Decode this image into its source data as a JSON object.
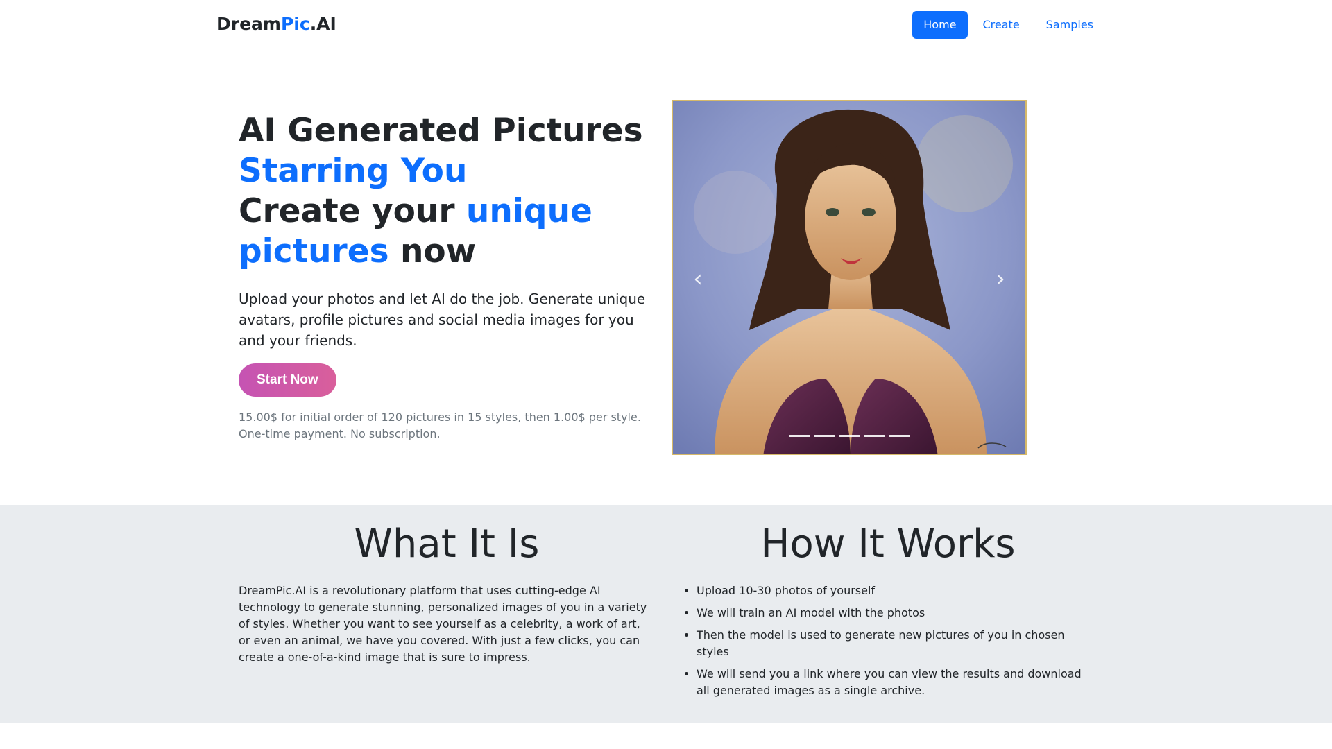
{
  "brand": {
    "part1": "Dream",
    "part2": "Pic",
    "part3": ".AI"
  },
  "nav": {
    "home": "Home",
    "create": "Create",
    "samples": "Samples"
  },
  "hero": {
    "line1": "AI Generated Pictures",
    "line2": "Starring You",
    "line3a": "Create your ",
    "line3b": "unique",
    "line4a": "pictures",
    "line4b": " now",
    "lead": "Upload your photos and let AI do the job. Generate unique avatars, profile pictures and social media images for you and your friends.",
    "cta": "Start Now",
    "price_line1": "15.00$ for initial order of 120 pictures in 15 styles, then 1.00$ per style.",
    "price_line2": "One-time payment. No subscription."
  },
  "carousel": {
    "prev_icon": "chevron-left-icon",
    "next_icon": "chevron-right-icon",
    "slides": 5,
    "active": 0
  },
  "what": {
    "title": "What It Is",
    "text": "DreamPic.AI is a revolutionary platform that uses cutting-edge AI technology to generate stunning, personalized images of you in a variety of styles. Whether you want to see yourself as a celebrity, a work of art, or even an animal, we have you covered. With just a few clicks, you can create a one-of-a-kind image that is sure to impress."
  },
  "how": {
    "title": "How It Works",
    "steps": [
      "Upload 10-30 photos of yourself",
      "We will train an AI model with the photos",
      "Then the model is used to generate new pictures of you in chosen styles",
      "We will send you a link where you can view the results and download all generated images as a single archive."
    ]
  },
  "colors": {
    "accent": "#0d6efd",
    "band": "#e9ecef",
    "cta_start": "#c553b3",
    "cta_end": "#d95f9b"
  }
}
